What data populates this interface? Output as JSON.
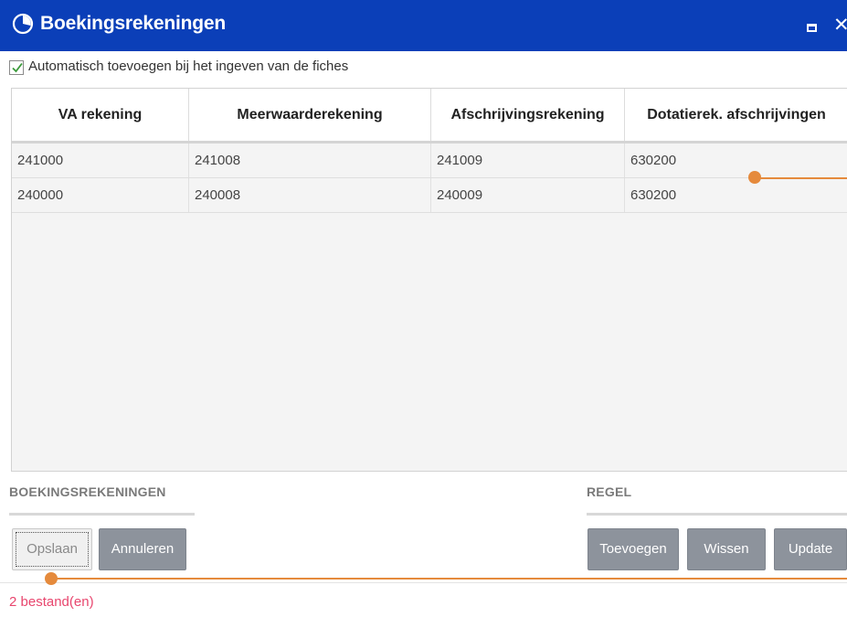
{
  "window": {
    "title": "Boekingsrekeningen",
    "icon": "clock-icon",
    "controls": [
      "maximize-icon",
      "close-icon"
    ],
    "close_glyph": "✕",
    "title_bar_color": "#0b3fb8"
  },
  "auto_add": {
    "checked": true,
    "label": "Automatisch toevoegen bij het ingeven van de fiches"
  },
  "grid": {
    "columns": [
      "VA rekening",
      "Meerwaarderekening",
      "Afschrijvingsrekening",
      "Dotatierek. afschrijvingen"
    ],
    "rows": [
      [
        "241000",
        "241008",
        "241009",
        "630200"
      ],
      [
        "240000",
        "240008",
        "240009",
        "630200"
      ]
    ]
  },
  "sections": {
    "left_title": "BOEKINGSREKENINGEN",
    "right_title": "REGEL"
  },
  "buttons": {
    "save": "Opslaan",
    "cancel": "Annuleren",
    "add": "Toevoegen",
    "delete": "Wissen",
    "update": "Update"
  },
  "status": {
    "text": "2 bestand(en)",
    "color": "#e8466e"
  },
  "callout_color": "#e58a3c"
}
